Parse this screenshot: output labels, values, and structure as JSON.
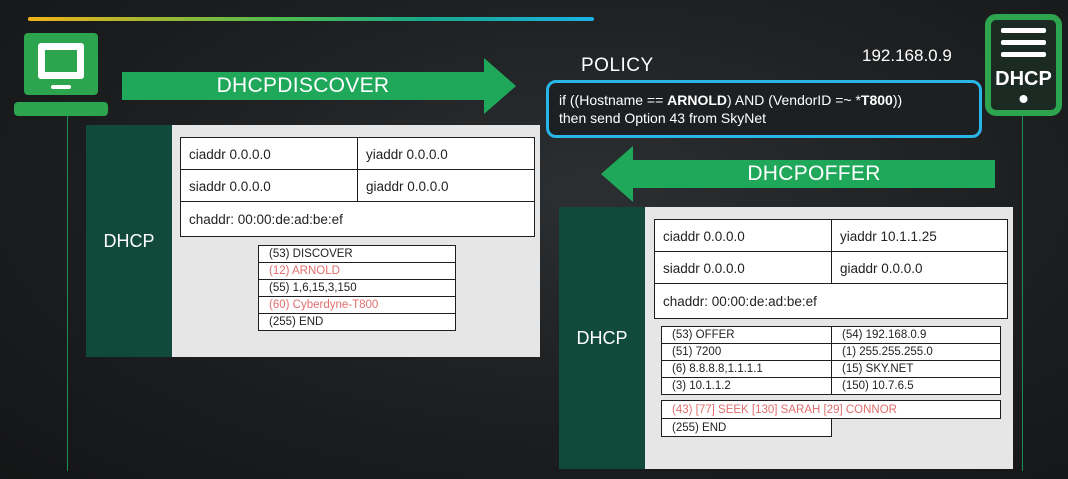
{
  "colors": {
    "accent_green": "#2da44e",
    "arrow_green": "#1fa85a",
    "policy_border": "#27b6e6",
    "dark_teal": "#114a3b",
    "highlight_red": "#e26e6e"
  },
  "icons": {
    "client": "laptop-icon",
    "server": "server-icon"
  },
  "server": {
    "label": "DHCP"
  },
  "arrows": {
    "discover": "DHCPDISCOVER",
    "offer": "DHCPOFFER"
  },
  "policy": {
    "title": "POLICY",
    "server_ip": "192.168.0.9",
    "line1_pre": "if ((Hostname == ",
    "line1_b1": "ARNOLD",
    "line1_mid": ") AND (VendorID =~ *",
    "line1_b2": "T800",
    "line1_post": "))",
    "line2": "then send Option 43 from SkyNet"
  },
  "discover_packet": {
    "label": "DHCP",
    "ciaddr": "ciaddr 0.0.0.0",
    "yiaddr": "yiaddr 0.0.0.0",
    "siaddr": "siaddr 0.0.0.0",
    "giaddr": "giaddr 0.0.0.0",
    "chaddr": "chaddr: 00:00:de:ad:be:ef",
    "options": [
      {
        "text": "(53) DISCOVER",
        "highlight": false
      },
      {
        "text": "(12) ARNOLD",
        "highlight": true
      },
      {
        "text": "(55) 1,6,15,3,150",
        "highlight": false
      },
      {
        "text": "(60) Cyberdyne-T800",
        "highlight": true
      },
      {
        "text": "(255) END",
        "highlight": false
      }
    ]
  },
  "offer_packet": {
    "label": "DHCP",
    "ciaddr": "ciaddr 0.0.0.0",
    "yiaddr": "yiaddr 10.1.1.25",
    "siaddr": "siaddr 0.0.0.0",
    "giaddr": "giaddr 0.0.0.0",
    "chaddr": "chaddr: 00:00:de:ad:be:ef",
    "options_left": [
      "(53) OFFER",
      "(51) 7200",
      "(6) 8.8.8.8,1.1.1.1",
      "(3) 10.1.1.2"
    ],
    "options_right": [
      "(54) 192.168.0.9",
      "(1) 255.255.255.0",
      "(15) SKY.NET",
      "(150) 10.7.6.5"
    ],
    "option_43": "(43) [77] SEEK [130] SARAH [29] CONNOR",
    "end": "(255) END"
  }
}
